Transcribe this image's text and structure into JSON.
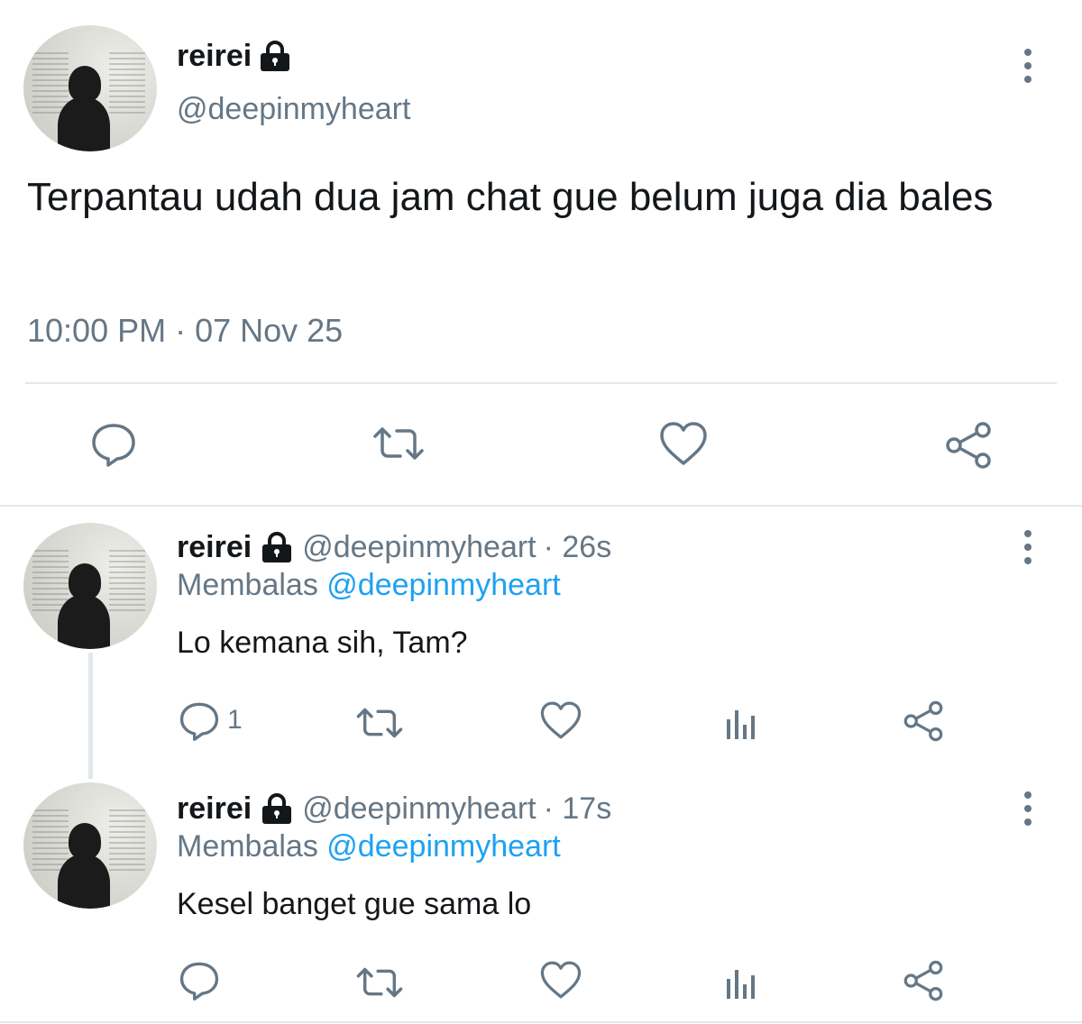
{
  "main_tweet": {
    "display_name": "reirei",
    "handle": "@deepinmyheart",
    "text": "Terpantau udah dua jam chat gue belum juga dia bales",
    "timestamp": "10:00 PM · 07 Nov 25",
    "actions": [
      "reply-icon",
      "retweet-icon",
      "like-icon",
      "share-icon"
    ],
    "protected_icon": "lock-icon"
  },
  "replies": [
    {
      "display_name": "reirei",
      "handle": "@deepinmyheart",
      "time": "· 26s",
      "replying_prefix": "Membalas",
      "replying_to": "@deepinmyheart",
      "text": "Lo kemana sih, Tam?",
      "reply_count": "1"
    },
    {
      "display_name": "reirei",
      "handle": "@deepinmyheart",
      "time": "· 17s",
      "replying_prefix": "Membalas",
      "replying_to": "@deepinmyheart",
      "text": "Kesel banget gue sama lo",
      "reply_count": ""
    }
  ],
  "colors": {
    "text": "#14171a",
    "secondary": "#657786",
    "link": "#1da1f2",
    "divider": "#e1e8ed"
  }
}
